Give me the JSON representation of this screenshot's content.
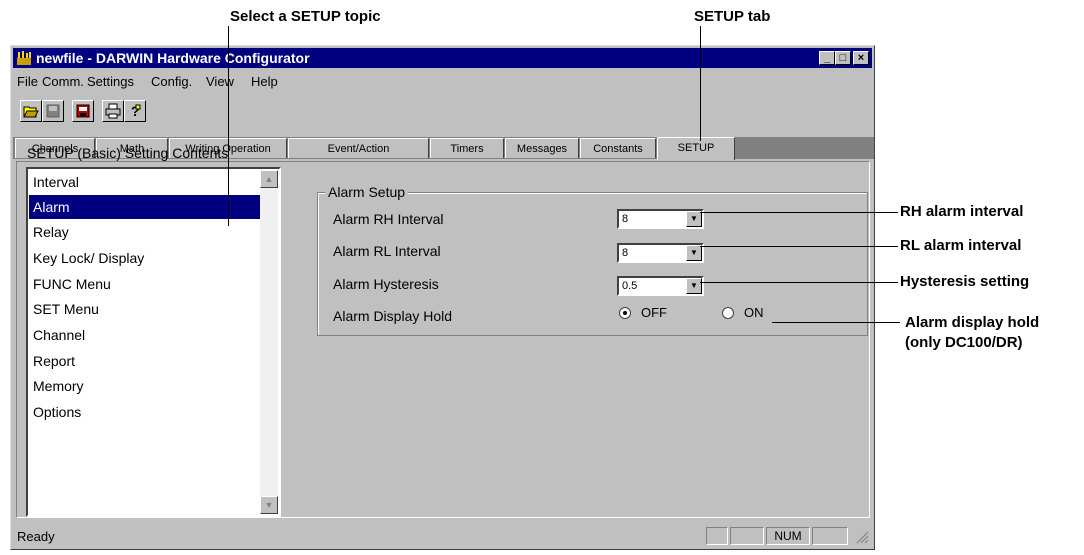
{
  "annotations": {
    "select_topic": "Select a SETUP topic",
    "setup_tab": "SETUP tab",
    "rh_interval": "RH alarm interval",
    "rl_interval": "RL alarm interval",
    "hysteresis": "Hysteresis setting",
    "display_hold_1": "Alarm display hold",
    "display_hold_2": "(only DC100/DR)"
  },
  "window": {
    "title": "newfile - DARWIN Hardware Configurator",
    "controls": [
      "_",
      "□",
      "×"
    ]
  },
  "menu": [
    "File",
    "Comm.",
    "Settings",
    "Config.",
    "View",
    "Help"
  ],
  "toolbar_icons": [
    "open-folder-icon",
    "save-icon",
    "transfer-icon",
    "print-icon",
    "help-icon"
  ],
  "tabs": [
    "Channels",
    "Math",
    "Writing Operation",
    "Event/Action",
    "Timers",
    "Messages",
    "Constants",
    "SETUP"
  ],
  "active_tab": "SETUP",
  "setup_list": {
    "title": "SETUP (Basic) Setting Contents",
    "items": [
      "Interval",
      "Alarm",
      "Relay",
      "Key Lock/ Display",
      "FUNC Menu",
      "SET Menu",
      "Channel",
      "Report",
      "Memory",
      "Options"
    ],
    "selected": "Alarm"
  },
  "alarm_setup": {
    "group_title": "Alarm Setup",
    "rh_label": "Alarm RH Interval",
    "rh_value": "8",
    "rl_label": "Alarm RL Interval",
    "rl_value": "8",
    "hyst_label": "Alarm Hysteresis",
    "hyst_value": "0.5",
    "hold_label": "Alarm Display Hold",
    "hold_off": "OFF",
    "hold_on": "ON",
    "hold_selected": "OFF"
  },
  "status": {
    "text": "Ready",
    "num": "NUM"
  }
}
